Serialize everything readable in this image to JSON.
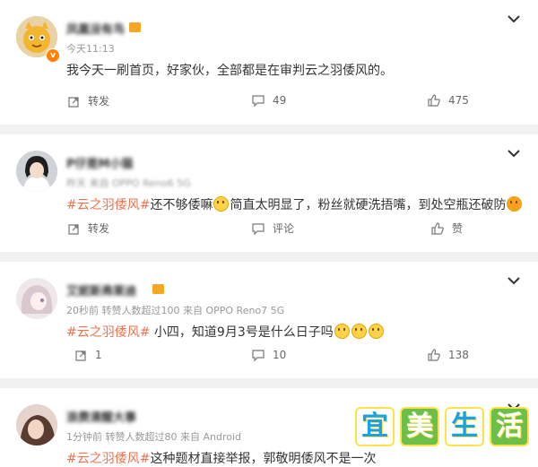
{
  "posts": [
    {
      "name": "凤凰没有鸟",
      "time": "今天11:13",
      "text": "我今天一刷首页，好家伙，全部都是在审判云之羽倭风的。",
      "actions": {
        "repost": "转发",
        "comment": "49",
        "like": "475"
      }
    },
    {
      "name": "P仔是M小猫",
      "time": "昨天 来自 OPPO Reno6 5G",
      "tag": "#云之羽倭风#",
      "text_a": "还不够倭嘛",
      "text_b": "简直太明显了，粉丝就硬洗捂嘴，到处空瓶还破防",
      "actions": {
        "repost": "转发",
        "comment": "评论",
        "like": "赞"
      }
    },
    {
      "name": "艾妮斯弗莱迪",
      "time": "20秒前 转赞人数超过100 来自 OPPO Reno7 5G",
      "tag": "#云之羽倭风#",
      "text_a": "小四，知道9月3号是什么日子吗",
      "actions": {
        "repost": "1",
        "comment": "10",
        "like": "138"
      }
    },
    {
      "name": "浪费清醒大事",
      "time": "1分钟前 转赞人数超过80 来自 Android",
      "tag": "#云之羽倭风#",
      "text_a": "这种题材直接举报，郭敬明倭风不是一次"
    }
  ],
  "watermark": [
    "宜",
    "美",
    "生",
    "活"
  ]
}
